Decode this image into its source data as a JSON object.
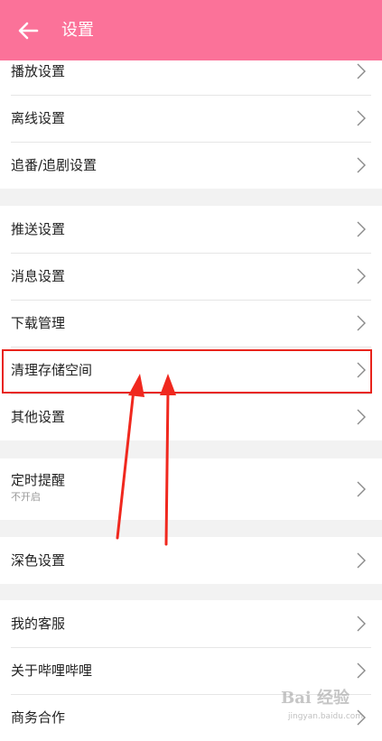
{
  "header": {
    "title": "设置",
    "back_icon": "arrow-left-icon",
    "background": "#fb7299"
  },
  "sections": [
    {
      "items": [
        {
          "label": "播放设置"
        },
        {
          "label": "离线设置"
        },
        {
          "label": "追番/追剧设置"
        }
      ]
    },
    {
      "items": [
        {
          "label": "推送设置"
        },
        {
          "label": "消息设置"
        },
        {
          "label": "下载管理"
        },
        {
          "label": "清理存储空间"
        },
        {
          "label": "其他设置"
        }
      ]
    },
    {
      "items": [
        {
          "label": "定时提醒",
          "sub": "不开启"
        }
      ]
    },
    {
      "items": [
        {
          "label": "深色设置"
        }
      ]
    },
    {
      "items": [
        {
          "label": "我的客服"
        },
        {
          "label": "关于哔哩哔哩"
        },
        {
          "label": "商务合作"
        }
      ]
    }
  ],
  "annotation": {
    "highlight_color": "#e8231b",
    "highlighted_item": "清理存储空间"
  },
  "watermark": {
    "text": "Bai 经验",
    "url": "jingyan.baidu.com"
  }
}
